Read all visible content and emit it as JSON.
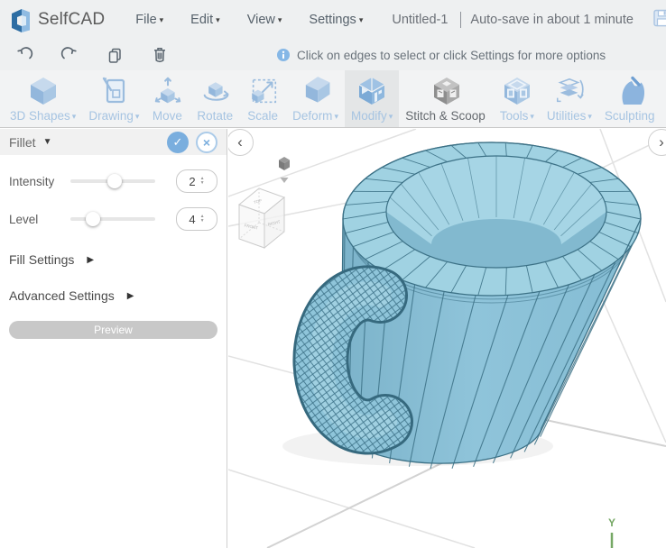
{
  "titlebar": {
    "app_name": "SelfCAD",
    "menus": [
      {
        "label": "File",
        "caret": "▾"
      },
      {
        "label": "Edit",
        "caret": "▾"
      },
      {
        "label": "View",
        "caret": "▾"
      },
      {
        "label": "Settings",
        "caret": "▾"
      }
    ],
    "document_name": "Untitled-1",
    "autosave_status": "Auto-save in about 1 minute",
    "save_icon": "floppy-disk"
  },
  "quickbar": {
    "actions": [
      "undo",
      "redo",
      "copy",
      "delete"
    ],
    "info_message": "Click on edges to select or click Settings for more options"
  },
  "toolbar": {
    "items": [
      {
        "label": "3D Shapes",
        "caret": "▾",
        "icon": "cube",
        "active": false
      },
      {
        "label": "Drawing",
        "caret": "▾",
        "icon": "drawing-board",
        "active": false
      },
      {
        "label": "Move",
        "caret": "",
        "icon": "move-cube",
        "active": false
      },
      {
        "label": "Rotate",
        "caret": "",
        "icon": "rotate-cube",
        "active": false
      },
      {
        "label": "Scale",
        "caret": "",
        "icon": "scale-cube",
        "active": false
      },
      {
        "label": "Deform",
        "caret": "▾",
        "icon": "deform-cube",
        "active": false
      },
      {
        "label": "Modify",
        "caret": "▾",
        "icon": "modify-cube",
        "active": true
      },
      {
        "label": "Stitch & Scoop",
        "caret": "",
        "icon": "stitch-cube",
        "active": false
      },
      {
        "label": "Tools",
        "caret": "▾",
        "icon": "tools-cube",
        "active": false
      },
      {
        "label": "Utilities",
        "caret": "▾",
        "icon": "layer-stack",
        "active": false
      },
      {
        "label": "Sculpting",
        "caret": "",
        "icon": "sculpt-hand",
        "active": false
      }
    ]
  },
  "panel": {
    "title": "Fillet",
    "title_caret": "▼",
    "confirm_glyph": "✓",
    "cancel_glyph": "×",
    "controls": [
      {
        "label": "Intensity",
        "value": 2,
        "slider_pct": 52
      },
      {
        "label": "Level",
        "value": 4,
        "slider_pct": 27
      }
    ],
    "stepper_up": "▲",
    "stepper_down": "▼",
    "sections": [
      {
        "label": "Fill Settings",
        "caret": "▶"
      },
      {
        "label": "Advanced Settings",
        "caret": "▶"
      }
    ],
    "preview_label": "Preview"
  },
  "viewport": {
    "nav_left": "‹",
    "nav_right": "›",
    "view_cube": {
      "top": "TOP",
      "front": "FRONT",
      "right": "RIGHT"
    },
    "axis_label": "Y",
    "colors": {
      "mug_fill": "#8cc3d8",
      "mug_edge": "#3c7186",
      "grid_line": "#e0e0e0",
      "axis_green": "#76a865",
      "accent_blue": "#7aaede",
      "info_blue": "#85b7e6"
    }
  }
}
